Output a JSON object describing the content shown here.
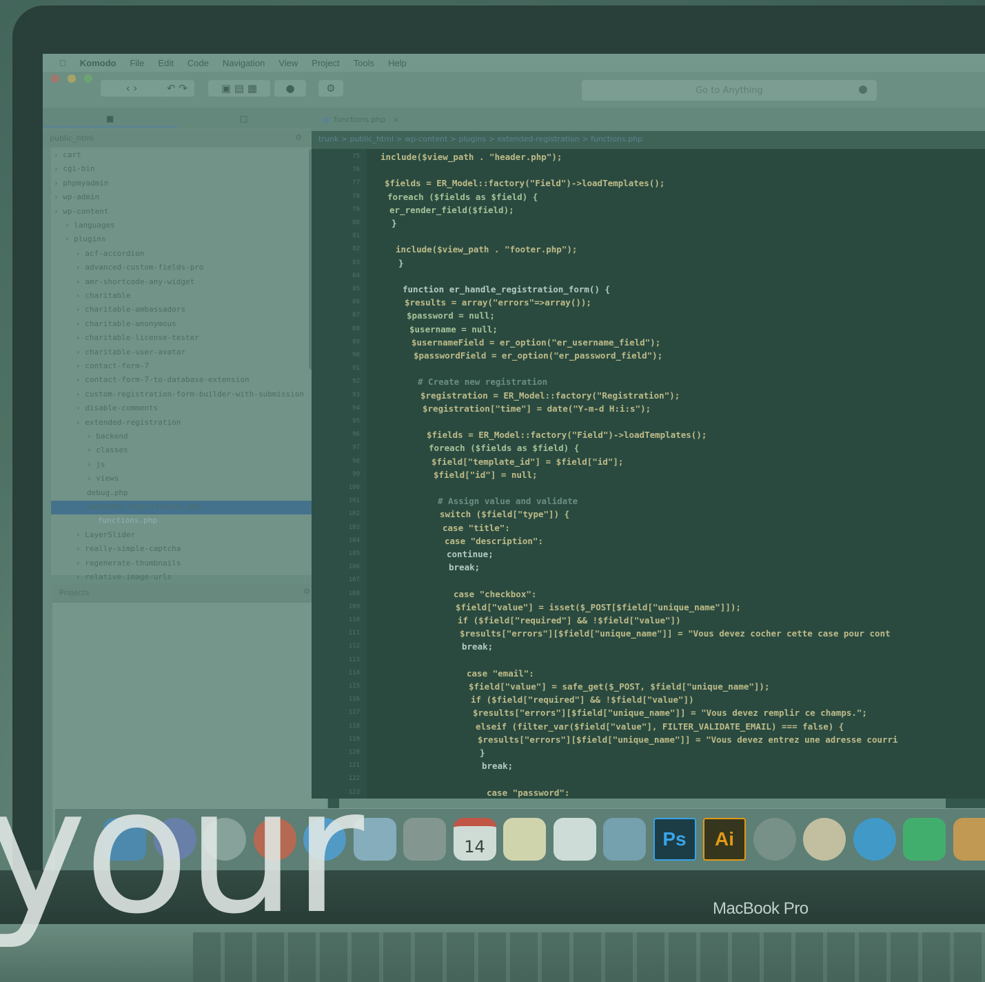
{
  "overlay_word": "your",
  "brand_label": "MacBook Pro",
  "menubar": {
    "items": [
      "Komodo",
      "File",
      "Edit",
      "Code",
      "Navigation",
      "View",
      "Project",
      "Tools",
      "Help"
    ]
  },
  "toolbar": {
    "goto_placeholder": "Go to Anything"
  },
  "side_panel": {
    "path": "public_html",
    "projects_label": "Projects",
    "tree": [
      "cart",
      "cgi-bin",
      "phpmyadmin",
      "wp-admin",
      "wp-content",
      "languages",
      "plugins",
      "acf-accordion",
      "advanced-custom-fields-pro",
      "amr-shortcode-any-widget",
      "charitable",
      "charitable-ambassadors",
      "charitable-anonymous",
      "charitable-license-tester",
      "charitable-user-avatar",
      "contact-form-7",
      "contact-form-7-to-database-extension",
      "custom-registration-form-builder-with-submission",
      "disable-comments",
      "extended-registration",
      "backend",
      "classes",
      "js",
      "views",
      "debug.php",
      "extended-registration.php",
      "functions.php",
      "LayerSlider",
      "really-simple-captcha",
      "regenerate-thumbnails",
      "relative-image-urls"
    ]
  },
  "editor": {
    "tab_label": "functions.php",
    "breadcrumb": "trunk > public_html > wp-content > plugins > extended-registration > functions.php",
    "line_numbers": [
      "75",
      "76",
      "77",
      "78",
      "79",
      "80",
      "81",
      "82",
      "83",
      "84",
      "85",
      "86",
      "87",
      "88",
      "89",
      "90",
      "91",
      "92",
      "93",
      "94",
      "95",
      "96",
      "97",
      "98",
      "99",
      "100",
      "101",
      "102",
      "103",
      "104",
      "105",
      "106",
      "107",
      "108",
      "109",
      "110",
      "111",
      "112",
      "113",
      "114",
      "115",
      "116",
      "117",
      "118",
      "119",
      "120",
      "121",
      "122",
      "123"
    ],
    "lines": [
      "include($view_path . \"header.php\");",
      "",
      "$fields = ER_Model::factory(\"Field\")->loadTemplates();",
      "foreach ($fields as $field) {",
      "    er_render_field($field);",
      "}",
      "",
      "include($view_path . \"footer.php\");",
      "}",
      "",
      "function er_handle_registration_form() {",
      "    $results = array(\"errors\"=>array());",
      "    $password = null;",
      "    $username = null;",
      "    $usernameField = er_option(\"er_username_field\");",
      "    $passwordField = er_option(\"er_password_field\");",
      "",
      "    # Create new registration",
      "    $registration = ER_Model::factory(\"Registration\");",
      "    $registration[\"time\"] = date(\"Y-m-d H:i:s\");",
      "",
      "    $fields = ER_Model::factory(\"Field\")->loadTemplates();",
      "    foreach ($fields as $field) {",
      "        $field[\"template_id\"] = $field[\"id\"];",
      "        $field[\"id\"] = null;",
      "",
      "        # Assign value and validate",
      "        switch ($field[\"type\"]) {",
      "            case \"title\":",
      "            case \"description\":",
      "                continue;",
      "                break;",
      "",
      "            case \"checkbox\":",
      "                $field[\"value\"] = isset($_POST[$field[\"unique_name\"]]);",
      "                if ($field[\"required\"] && !$field[\"value\"])",
      "                    $results[\"errors\"][$field[\"unique_name\"]] = \"Vous devez cocher cette case pour cont",
      "                break;",
      "",
      "            case \"email\":",
      "                $field[\"value\"] = safe_get($_POST, $field[\"unique_name\"]);",
      "                if ($field[\"required\"] && !$field[\"value\"])",
      "                    $results[\"errors\"][$field[\"unique_name\"]] = \"Vous devez remplir ce champs.\";",
      "                elseif (filter_var($field[\"value\"], FILTER_VALIDATE_EMAIL) === false) {",
      "                    $results[\"errors\"][$field[\"unique_name\"]] = \"Vous devez entrez une adresse courri",
      "                }",
      "                break;",
      "",
      "            case \"password\":"
    ]
  },
  "dock": {
    "icons": [
      "finder-icon",
      "siri-icon",
      "launchpad-icon",
      "chrome-icon",
      "safari-icon",
      "mail-icon",
      "system-preferences-icon",
      "calendar-icon",
      "notes-icon",
      "reminders-icon",
      "preview-icon",
      "photoshop-icon",
      "illustrator-icon",
      "cinema4d-icon",
      "photos-icon",
      "messages-icon",
      "facetime-icon",
      "pages-icon"
    ],
    "calendar_day": "14",
    "ps_label": "Ps",
    "ai_label": "Ai"
  },
  "colors": {
    "overlay_tint": "#5c9682",
    "selection": "#3f6b90",
    "photoshop": "#31a8ff",
    "illustrator": "#ff9a00"
  }
}
